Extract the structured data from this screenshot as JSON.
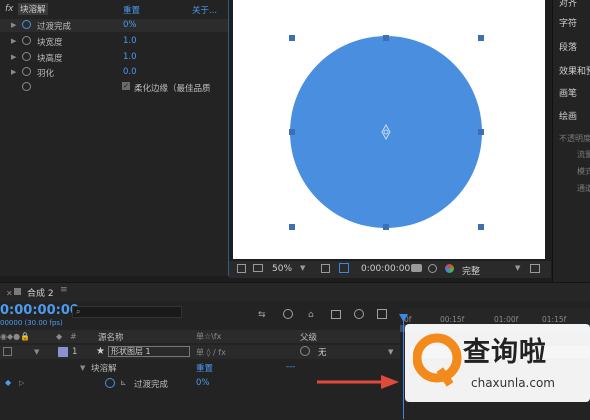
{
  "effect_controls": {
    "fx": "fx",
    "effect_name": "块溶解",
    "reset": "重置",
    "about": "关于...",
    "properties": [
      {
        "label": "过渡完成",
        "value": "0%"
      },
      {
        "label": "块宽度",
        "value": "1.0"
      },
      {
        "label": "块高度",
        "value": "1.0"
      },
      {
        "label": "羽化",
        "value": "0.0"
      }
    ],
    "checkbox_label": "柔化边缘（最佳品质"
  },
  "viewer": {
    "zoom": "50%",
    "timecode": "0:00:00:00",
    "resolution": "完整",
    "fill_color": "#4a8ee0"
  },
  "right_panel": {
    "items": [
      "对齐",
      "字符",
      "段落",
      "效果和预",
      "画笔",
      "绘画"
    ],
    "subitems": [
      "不透明度",
      "流量",
      "模式",
      "通道"
    ]
  },
  "timeline": {
    "comp_tab": "合成 2",
    "timecode": "0:00:00:00",
    "fps": "00000 (30.00 fps)",
    "search_placeholder": "",
    "col_source": "源名称",
    "col_switches": "单☆\\fx",
    "col_parent": "父级",
    "ruler_labels": [
      "0f",
      "00:15f",
      "01:00f",
      "01:15f"
    ],
    "layer": {
      "index": "1",
      "name": "形状图层 1",
      "parent": "无"
    },
    "effect_row": {
      "name": "块溶解",
      "reset": "重置",
      "dots": "---"
    },
    "prop_row": {
      "name": "过渡完成",
      "value": "0%"
    }
  },
  "watermark": {
    "title": "查询啦",
    "sub": "chaxunla.com"
  }
}
